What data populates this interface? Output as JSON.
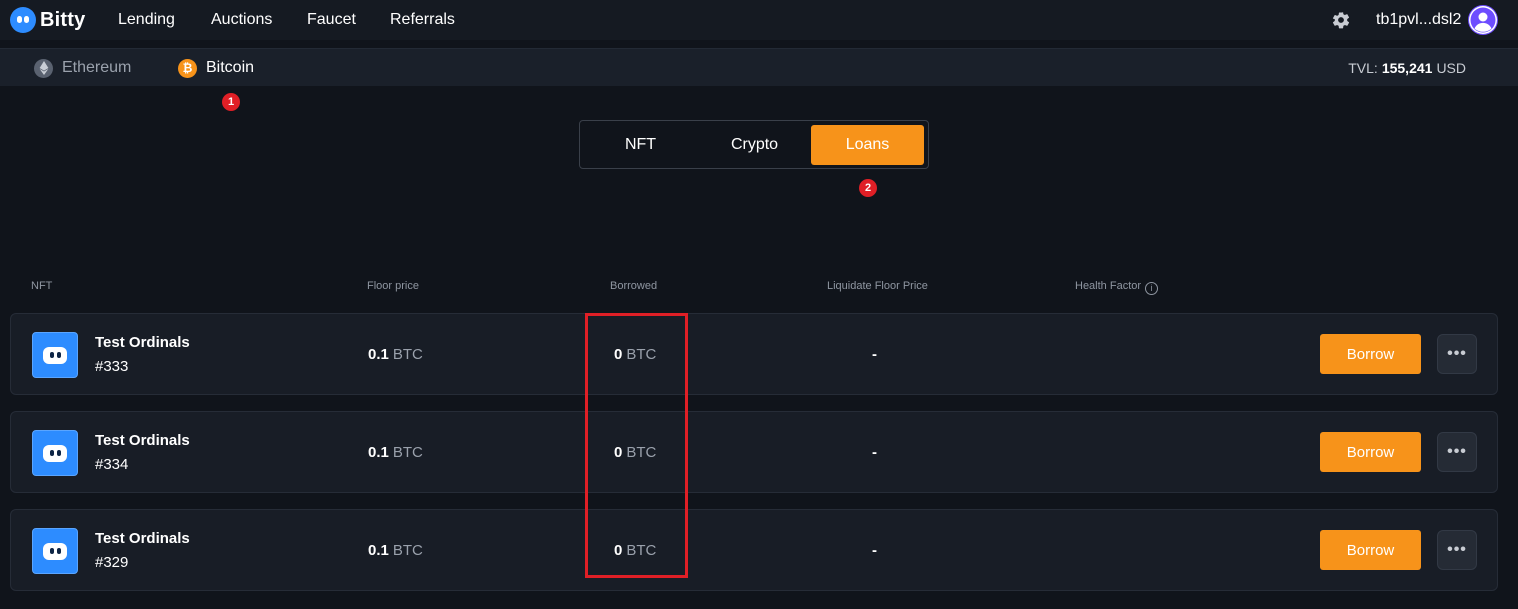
{
  "brand": {
    "name": "Bitty"
  },
  "nav": {
    "links": [
      "Lending",
      "Auctions",
      "Faucet",
      "Referrals"
    ],
    "wallet": "tb1pvl...dsl2"
  },
  "chains": [
    {
      "label": "Ethereum"
    },
    {
      "label": "Bitcoin"
    }
  ],
  "tvl": {
    "label": "TVL:",
    "value": "155,241",
    "unit": "USD"
  },
  "annotations": [
    "1",
    "2"
  ],
  "tabs": [
    "NFT",
    "Crypto",
    "Loans"
  ],
  "active_tab": "Loans",
  "table": {
    "headers": {
      "nft": "NFT",
      "floor": "Floor price",
      "borrowed": "Borrowed",
      "liquidate": "Liquidate Floor Price",
      "health": "Health Factor"
    },
    "rows": [
      {
        "name": "Test Ordinals",
        "id": "#333",
        "floor_value": "0.1",
        "floor_unit": "BTC",
        "borrowed_value": "0",
        "borrowed_unit": "BTC",
        "liquidate": "-",
        "action": "Borrow"
      },
      {
        "name": "Test Ordinals",
        "id": "#334",
        "floor_value": "0.1",
        "floor_unit": "BTC",
        "borrowed_value": "0",
        "borrowed_unit": "BTC",
        "liquidate": "-",
        "action": "Borrow"
      },
      {
        "name": "Test Ordinals",
        "id": "#329",
        "floor_value": "0.1",
        "floor_unit": "BTC",
        "borrowed_value": "0",
        "borrowed_unit": "BTC",
        "liquidate": "-",
        "action": "Borrow"
      }
    ]
  },
  "icons": {
    "settings": "gear-icon",
    "more": "ellipsis-icon",
    "info": "info-icon",
    "ethereum": "ethereum-icon",
    "bitcoin": "bitcoin-icon"
  },
  "colors": {
    "accent": "#f7931a",
    "brand": "#2d8cff",
    "annotation": "#e01f26",
    "background": "#10141b"
  }
}
